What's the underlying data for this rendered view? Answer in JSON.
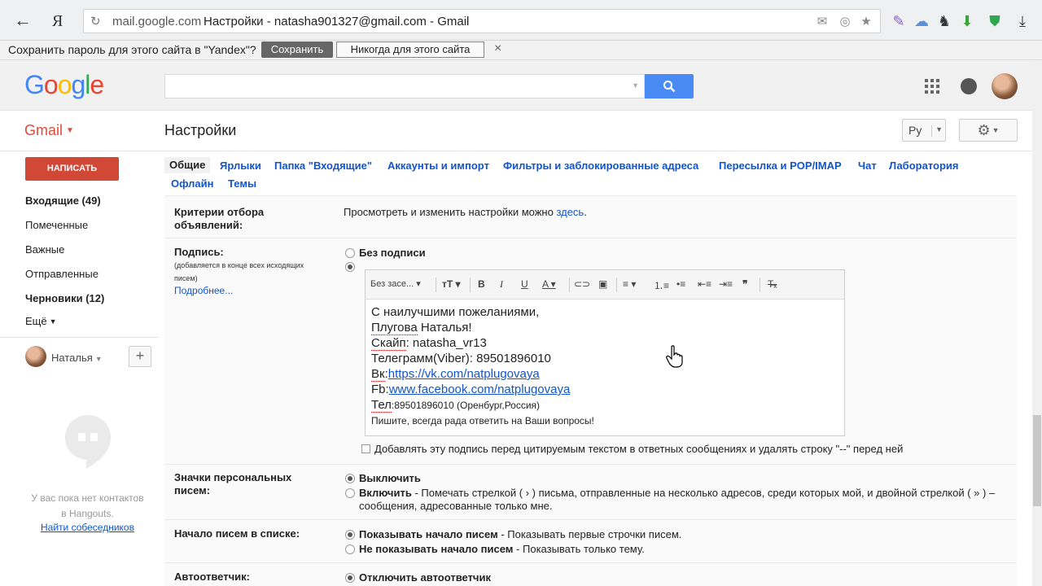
{
  "browser": {
    "back_glyph": "←",
    "yandex_logo": "Я",
    "reload_glyph": "↻",
    "url_domain": "mail.google.com",
    "url_title": "Настройки - natasha901327@gmail.com - Gmail"
  },
  "password_bar": {
    "text": "Сохранить пароль для этого сайта в \"Yandex\"?",
    "save_label": "Сохранить",
    "never_label": "Никогда для этого сайта",
    "close_glyph": "×"
  },
  "header": {
    "logo": [
      "G",
      "o",
      "o",
      "g",
      "l",
      "e"
    ],
    "search_placeholder": ""
  },
  "subheader": {
    "gmail_label": "Gmail",
    "page_title": "Настройки",
    "lang": "Ру"
  },
  "sidebar": {
    "compose_label": "НАПИСАТЬ",
    "items": [
      {
        "label": "Входящие (49)"
      },
      {
        "label": "Помеченные"
      },
      {
        "label": "Важные"
      },
      {
        "label": "Отправленные"
      },
      {
        "label": "Черновики (12)"
      },
      {
        "label": "Ещё"
      }
    ],
    "user_name": "Наталья",
    "hangouts_text_1": "У вас пока нет контактов",
    "hangouts_text_2": "в Hangouts.",
    "hangouts_link": "Найти собеседников"
  },
  "tabs": [
    {
      "label": "Общие"
    },
    {
      "label": "Ярлыки"
    },
    {
      "label": "Папка \"Входящие\""
    },
    {
      "label": "Аккаунты и импорт"
    },
    {
      "label": "Фильтры и заблокированные адреса"
    },
    {
      "label": "Пересылка и POP/IMAP"
    },
    {
      "label": "Чат"
    },
    {
      "label": "Лаборатория"
    },
    {
      "label": "Офлайн"
    },
    {
      "label": "Темы"
    }
  ],
  "settings": {
    "ads": {
      "label_1": "Критерии отбора",
      "label_2": "объявлений:",
      "text": "Просмотреть и изменить настройки можно ",
      "link": "здесь",
      "after": "."
    },
    "signature": {
      "label": "Подпись:",
      "sub_1": "(добавляется в конце всех исходящих",
      "sub_2": "писем)",
      "more": "Подробнее...",
      "no_sig": "Без подписи",
      "font": "Без засе...",
      "lines": [
        "С наилучшими пожеланиями,",
        "Плугова",
        " Наталья!",
        "Скайп",
        ": natasha_vr13",
        "Телеграмм(Viber): 89501896010",
        "Вк",
        ":",
        "https://vk.com/natplugovaya",
        "Fb:",
        "www.facebook.com/natplugovaya",
        "Тел",
        ":89501896010 (Оренбург,Россия)",
        "Пишите, всегда рада ответить на Ваши вопросы!"
      ],
      "checkbox_text": "Добавлять эту подпись перед цитируемым текстом в ответных сообщениях и удалять строку \"--\" перед ней"
    },
    "indicators": {
      "label_1": "Значки персональных",
      "label_2": "писем:",
      "off": "Выключить",
      "on_bold": "Включить",
      "on_desc": " - Помечать стрелкой ( › ) письма, отправленные на несколько адресов, среди которых мой, и двойной стрелкой ( » ) –",
      "on_desc_2": "сообщения, адресованные только мне."
    },
    "snippets": {
      "label": "Начало писем в списке:",
      "show_bold": "Показывать начало писем",
      "show_desc": " - Показывать первые строчки писем.",
      "hide_bold": "Не показывать начало писем",
      "hide_desc": " - Показывать только тему."
    },
    "vacation": {
      "label": "Автоответчик:",
      "off": "Отключить автоответчик"
    }
  },
  "colors": {
    "compose": "#d14836",
    "gmail_red": "#dd4b39",
    "link": "#1155cc",
    "search_blue": "#4a8af4"
  }
}
